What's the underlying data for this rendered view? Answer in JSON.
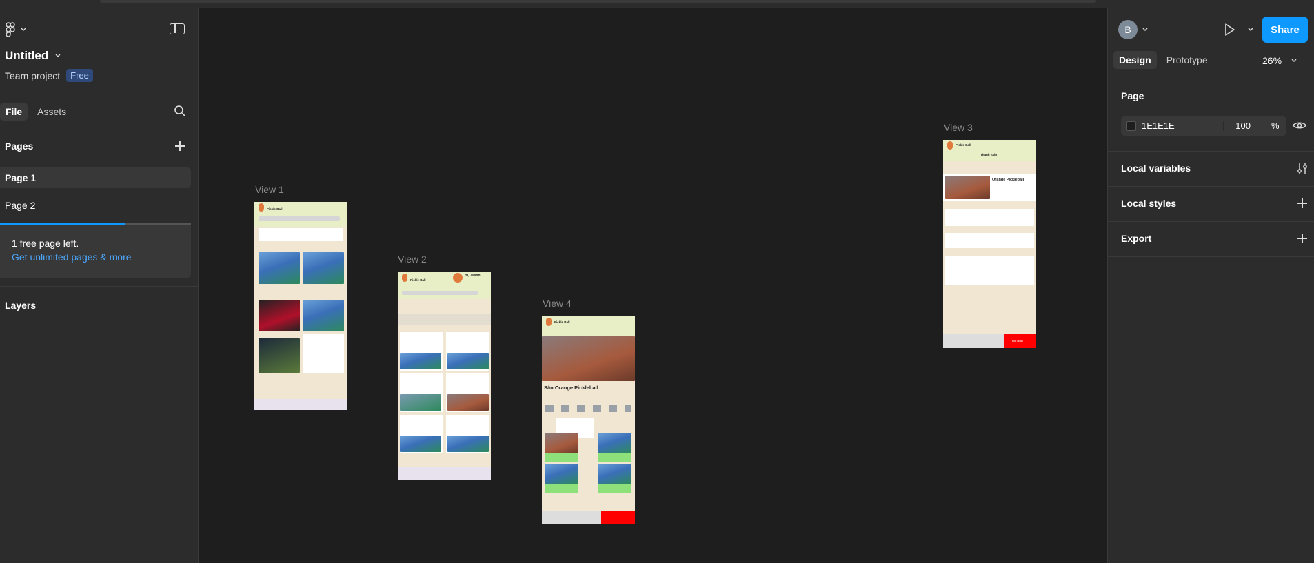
{
  "file": {
    "title": "Untitled",
    "project": "Team project",
    "plan_badge": "Free"
  },
  "left_tabs": {
    "file": "File",
    "assets": "Assets"
  },
  "pages": {
    "heading": "Pages",
    "items": [
      {
        "label": "Page 1"
      },
      {
        "label": "Page 2"
      }
    ]
  },
  "limit": {
    "text": "1 free page left.",
    "link": "Get unlimited pages & more"
  },
  "layers": {
    "heading": "Layers"
  },
  "right": {
    "avatar": "B",
    "share": "Share",
    "tabs": {
      "design": "Design",
      "prototype": "Prototype"
    },
    "zoom": "26%",
    "page_heading": "Page",
    "bg_hex": "1E1E1E",
    "bg_opacity": "100",
    "pct": "%",
    "sections": {
      "variables": "Local variables",
      "styles": "Local styles",
      "export": "Export"
    }
  },
  "frames": {
    "view1": {
      "label": "View 1",
      "brand": "Pickle Ball"
    },
    "view2": {
      "label": "View 2",
      "brand": "Pickle Ball",
      "greeting": "Hi, Justin"
    },
    "view3": {
      "label": "View 3",
      "brand": "Pickle Ball",
      "header": "Thanh toán",
      "venue": "Orange Pickleball",
      "btn": "Đặt ngay"
    },
    "view4": {
      "label": "View 4",
      "brand": "Pickle Ball",
      "venue": "Sân Orange Pickleball"
    }
  },
  "colors": {
    "accent": "#0d99ff",
    "canvas": "#1e1e1e",
    "panel": "#2c2c2c",
    "frame_bg": "#f1e6d1",
    "frame_head": "#e8efc6"
  }
}
